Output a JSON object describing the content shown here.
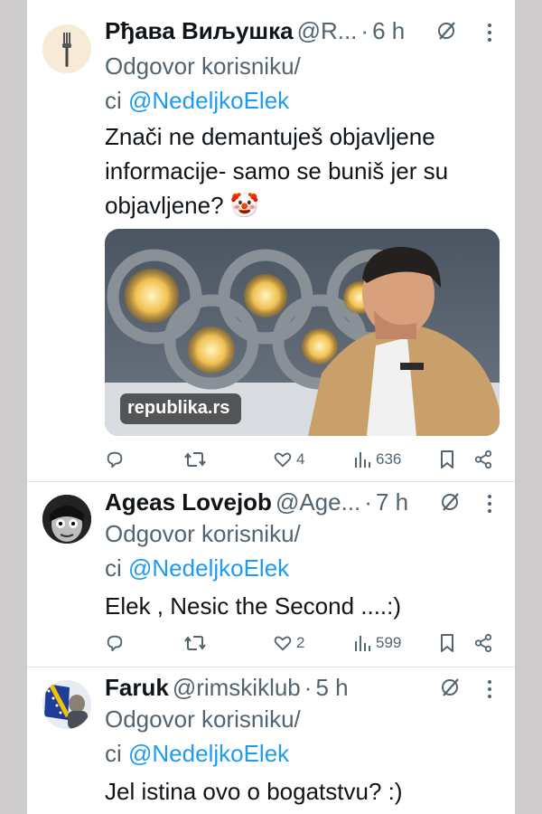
{
  "tweets": [
    {
      "author": "Рђава Виљушка",
      "handle": "@R...",
      "time": "6 h",
      "reply_prefix": "Odgovor korisniku/",
      "reply_ci": "ci",
      "reply_to": "@NedeljkoElek",
      "text_lines": [
        "Znači ne demantuješ objavljene",
        "informacije- samo se buniš jer su",
        "objavljene? 🤡"
      ],
      "media_source": "republika.rs",
      "likes": "4",
      "views": "636",
      "avatar_icon": "fork-icon"
    },
    {
      "author": "Ageas Lovejob",
      "handle": "@Age...",
      "time": "7 h",
      "reply_prefix": "Odgovor korisniku/",
      "reply_ci": "ci",
      "reply_to": "@NedeljkoElek",
      "text_lines": [
        "Elek , Nesic the Second ....:)"
      ],
      "likes": "2",
      "views": "599",
      "avatar_icon": "face-avatar"
    },
    {
      "author": "Faruk",
      "handle": "@rimskiklub",
      "time": "5 h",
      "reply_prefix": "Odgovor korisniku/",
      "reply_ci": "ci",
      "reply_to": "@NedeljkoElek",
      "text_lines": [
        "Jel istina ovo o bogatstvu? :)"
      ],
      "avatar_icon": "flag-avatar"
    }
  ],
  "colors": {
    "link": "#1d9bf0",
    "secondary": "#536471",
    "text": "#0f1419"
  }
}
